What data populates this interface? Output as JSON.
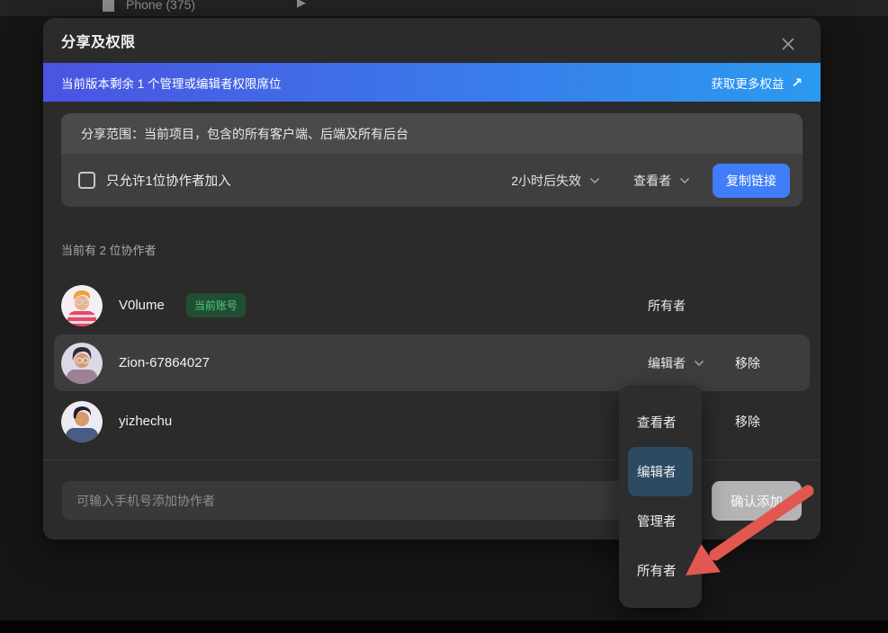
{
  "background": {
    "frame_label": "Phone (375)",
    "play_icon": "▶"
  },
  "modal": {
    "title": "分享及权限",
    "banner": {
      "text": "当前版本剩余 1 个管理或编辑者权限席位",
      "link_label": "获取更多权益",
      "link_arrow": "↗",
      "gradient_left": "#4c53e2",
      "gradient_right": "#2b9af0"
    },
    "scope": {
      "header": "分享范围：当前项目，包含的所有客户端、后端及所有后台",
      "checkbox_label": "只允许1位协作者加入",
      "checkbox_checked": false,
      "expire_select_value": "2小时后失效",
      "role_select_value": "查看者",
      "copy_button_label": "复制链接"
    },
    "collaborators": {
      "count_text": "当前有 2 位协作者",
      "rows": [
        {
          "name": "V0lume",
          "badge": "当前账号",
          "role": "所有者"
        },
        {
          "name": "Zion-67864027",
          "role": "编辑者",
          "remove_label": "移除",
          "highlighted": true
        },
        {
          "name": "yizhechu",
          "remove_label": "移除"
        }
      ]
    },
    "footer": {
      "input_placeholder": "可输入手机号添加协作者",
      "input_value": "",
      "confirm_button_label": "确认添加",
      "confirm_disabled": true
    }
  },
  "role_dropdown": {
    "items": [
      {
        "label": "查看者"
      },
      {
        "label": "编辑者",
        "selected": true
      },
      {
        "label": "管理者"
      },
      {
        "label": "所有者"
      }
    ],
    "selected_color": "#2d4a63"
  },
  "annotation": {
    "arrow_color": "#e2574f",
    "points_to": "所有者"
  },
  "colors": {
    "page_bg": "#161616",
    "modal_bg": "#2b2b2b",
    "accent_blue": "#3f7ef8",
    "badge_green": "#4ecb7f",
    "badge_green_bg": "#214d33"
  }
}
